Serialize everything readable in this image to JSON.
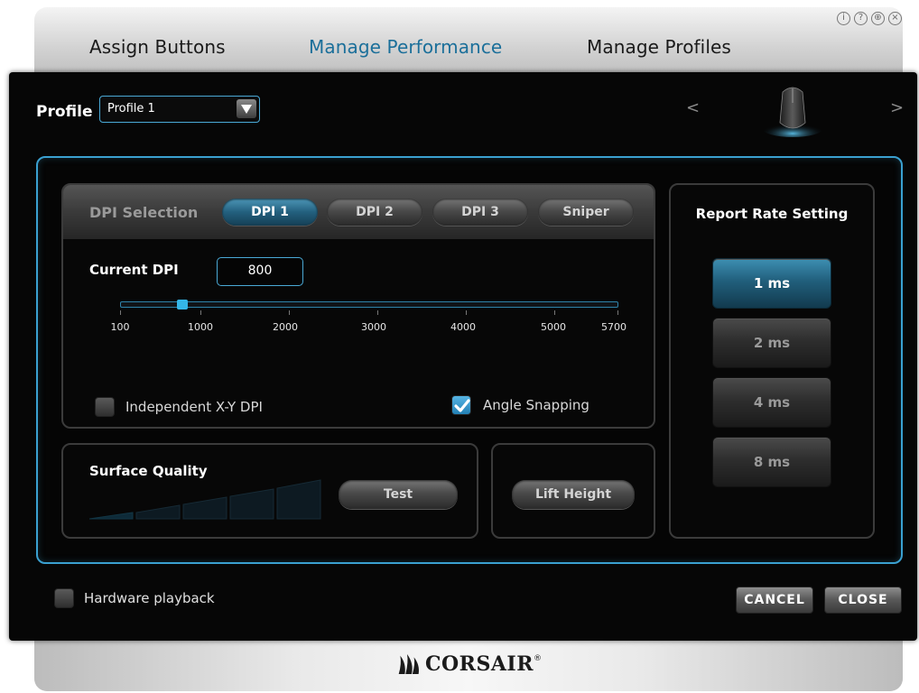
{
  "tabs": [
    {
      "label": "Assign Buttons",
      "active": false
    },
    {
      "label": "Manage Performance",
      "active": true
    },
    {
      "label": "Manage Profiles",
      "active": false
    }
  ],
  "window_icons": [
    {
      "name": "info-icon",
      "glyph": "i"
    },
    {
      "name": "help-icon",
      "glyph": "?"
    },
    {
      "name": "globe-icon",
      "glyph": "⊕"
    },
    {
      "name": "close-icon",
      "glyph": "×"
    }
  ],
  "profile": {
    "label": "Profile",
    "selected": "Profile 1"
  },
  "nav": {
    "prev": "<",
    "next": ">"
  },
  "dpi": {
    "title": "DPI Selection",
    "buttons": [
      {
        "label": "DPI 1",
        "active": true
      },
      {
        "label": "DPI 2",
        "active": false
      },
      {
        "label": "DPI 3",
        "active": false
      },
      {
        "label": "Sniper",
        "active": false
      }
    ],
    "current_label": "Current DPI",
    "current_value": "800",
    "slider": {
      "min": 100,
      "max": 5700,
      "value": 800
    },
    "ticks": [
      "100",
      "1000",
      "2000",
      "3000",
      "4000",
      "5000",
      "5700"
    ],
    "independent_xy": {
      "label": "Independent X-Y DPI",
      "checked": false
    },
    "angle_snapping": {
      "label": "Angle Snapping",
      "checked": true
    }
  },
  "surface": {
    "title": "Surface Quality",
    "test_label": "Test",
    "quality_level": 1
  },
  "lift": {
    "label": "Lift Height"
  },
  "report": {
    "title": "Report Rate Setting",
    "options": [
      {
        "label": "1 ms",
        "active": true
      },
      {
        "label": "2 ms",
        "active": false
      },
      {
        "label": "4 ms",
        "active": false
      },
      {
        "label": "8 ms",
        "active": false
      }
    ]
  },
  "footer": {
    "hardware_playback": {
      "label": "Hardware playback",
      "checked": false
    },
    "cancel_label": "CANCEL",
    "close_label": "CLOSE"
  },
  "brand": {
    "logo_text": "CORSAIR",
    "trademark": "®"
  },
  "colors": {
    "accent": "#3aa0d0",
    "active_tab": "#1b6f9a"
  }
}
